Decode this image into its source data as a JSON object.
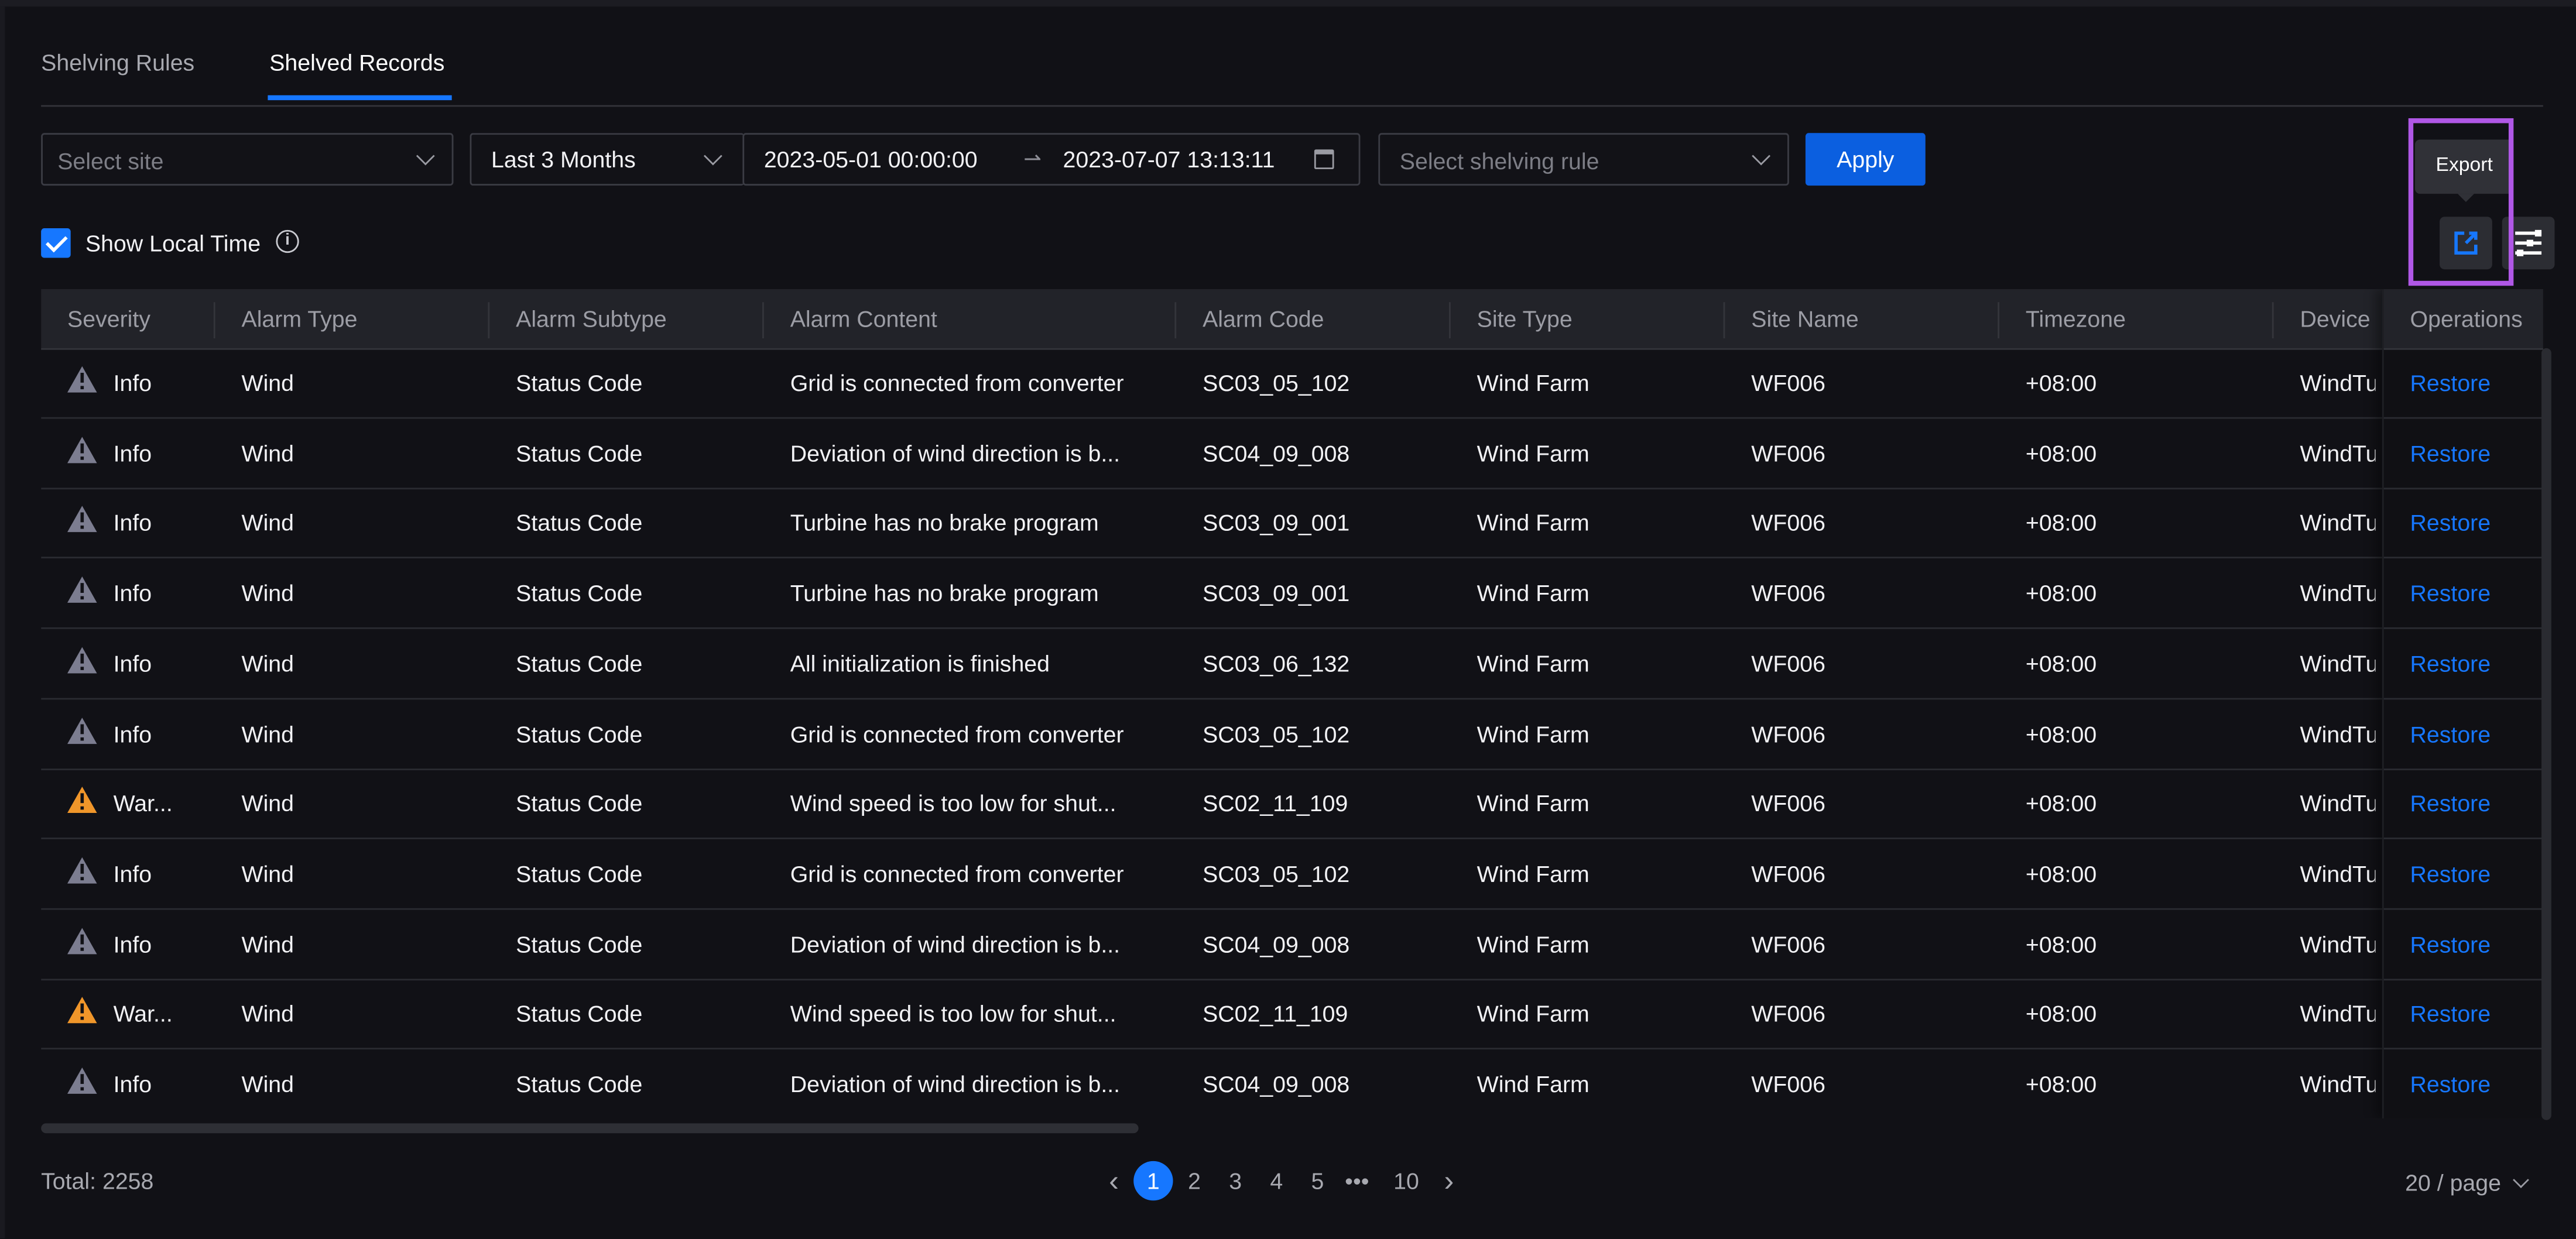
{
  "tabs": [
    {
      "label": "Shelving Rules",
      "active": false
    },
    {
      "label": "Shelved Records",
      "active": true
    }
  ],
  "filters": {
    "site_placeholder": "Select site",
    "range_preset": "Last 3 Months",
    "date_start": "2023-05-01 00:00:00",
    "date_end": "2023-07-07 13:13:11",
    "rule_placeholder": "Select shelving rule",
    "apply_label": "Apply"
  },
  "options": {
    "show_local_time_label": "Show Local Time",
    "show_local_time_checked": true,
    "info_glyph": "i"
  },
  "toolbar": {
    "export_tooltip": "Export",
    "export_icon": "export-icon",
    "settings_icon": "column-settings-icon"
  },
  "colors": {
    "accent": "#1677ff",
    "apply": "#0b5fe0",
    "warning": "#f0962a",
    "info": "#7c7d90",
    "highlight": "#b057e6"
  },
  "table": {
    "columns": [
      "Severity",
      "Alarm Type",
      "Alarm Subtype",
      "Alarm Content",
      "Alarm Code",
      "Site Type",
      "Site Name",
      "Timezone",
      "Device",
      "Operations"
    ],
    "rows": [
      {
        "severity": "Info",
        "sev_type": "info",
        "type": "Wind",
        "subtype": "Status Code",
        "content": "Grid is connected from converter",
        "code": "SC03_05_102",
        "site_type": "Wind Farm",
        "site_name": "WF006",
        "tz": "+08:00",
        "device": "WindTu",
        "op": "Restore"
      },
      {
        "severity": "Info",
        "sev_type": "info",
        "type": "Wind",
        "subtype": "Status Code",
        "content": "Deviation of wind direction is b...",
        "code": "SC04_09_008",
        "site_type": "Wind Farm",
        "site_name": "WF006",
        "tz": "+08:00",
        "device": "WindTu",
        "op": "Restore"
      },
      {
        "severity": "Info",
        "sev_type": "info",
        "type": "Wind",
        "subtype": "Status Code",
        "content": "Turbine has no brake program",
        "code": "SC03_09_001",
        "site_type": "Wind Farm",
        "site_name": "WF006",
        "tz": "+08:00",
        "device": "WindTu",
        "op": "Restore"
      },
      {
        "severity": "Info",
        "sev_type": "info",
        "type": "Wind",
        "subtype": "Status Code",
        "content": "Turbine has no brake program",
        "code": "SC03_09_001",
        "site_type": "Wind Farm",
        "site_name": "WF006",
        "tz": "+08:00",
        "device": "WindTu",
        "op": "Restore"
      },
      {
        "severity": "Info",
        "sev_type": "info",
        "type": "Wind",
        "subtype": "Status Code",
        "content": "All initialization is finished",
        "code": "SC03_06_132",
        "site_type": "Wind Farm",
        "site_name": "WF006",
        "tz": "+08:00",
        "device": "WindTu",
        "op": "Restore"
      },
      {
        "severity": "Info",
        "sev_type": "info",
        "type": "Wind",
        "subtype": "Status Code",
        "content": "Grid is connected from converter",
        "code": "SC03_05_102",
        "site_type": "Wind Farm",
        "site_name": "WF006",
        "tz": "+08:00",
        "device": "WindTu",
        "op": "Restore"
      },
      {
        "severity": "War...",
        "sev_type": "warn",
        "type": "Wind",
        "subtype": "Status Code",
        "content": "Wind speed is too low for shut...",
        "code": "SC02_11_109",
        "site_type": "Wind Farm",
        "site_name": "WF006",
        "tz": "+08:00",
        "device": "WindTu",
        "op": "Restore"
      },
      {
        "severity": "Info",
        "sev_type": "info",
        "type": "Wind",
        "subtype": "Status Code",
        "content": "Grid is connected from converter",
        "code": "SC03_05_102",
        "site_type": "Wind Farm",
        "site_name": "WF006",
        "tz": "+08:00",
        "device": "WindTu",
        "op": "Restore"
      },
      {
        "severity": "Info",
        "sev_type": "info",
        "type": "Wind",
        "subtype": "Status Code",
        "content": "Deviation of wind direction is b...",
        "code": "SC04_09_008",
        "site_type": "Wind Farm",
        "site_name": "WF006",
        "tz": "+08:00",
        "device": "WindTu",
        "op": "Restore"
      },
      {
        "severity": "War...",
        "sev_type": "warn",
        "type": "Wind",
        "subtype": "Status Code",
        "content": "Wind speed is too low for shut...",
        "code": "SC02_11_109",
        "site_type": "Wind Farm",
        "site_name": "WF006",
        "tz": "+08:00",
        "device": "WindTu",
        "op": "Restore"
      },
      {
        "severity": "Info",
        "sev_type": "info",
        "type": "Wind",
        "subtype": "Status Code",
        "content": "Deviation of wind direction is b...",
        "code": "SC04_09_008",
        "site_type": "Wind Farm",
        "site_name": "WF006",
        "tz": "+08:00",
        "device": "WindTu",
        "op": "Restore"
      }
    ]
  },
  "footer": {
    "total_label": "Total: 2258",
    "pages": [
      "1",
      "2",
      "3",
      "4",
      "5",
      "•••",
      "10"
    ],
    "current_page": "1",
    "prev_glyph": "‹",
    "next_glyph": "›",
    "page_size": "20 / page"
  }
}
